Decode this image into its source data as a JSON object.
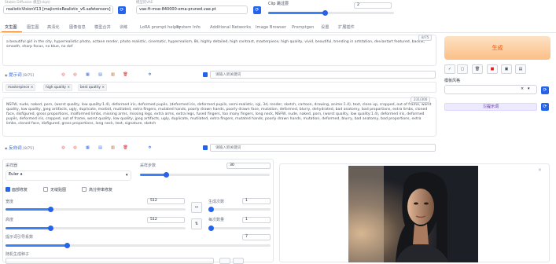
{
  "top": {
    "model_label": "Stable Diffusion 模型(ckpt)",
    "model_value": "realisticVisionV13 [majicmixRealistic_v6.safetensors]",
    "vae_label": "模型的VAE",
    "vae_value": "vae-ft-mse-840000-ema-pruned.vae.pt",
    "clip_label": "Clip 跳过层",
    "clip_value": "2",
    "clip_level": 0.45
  },
  "tabs": [
    "文生图",
    "图生图",
    "高清化",
    "图像信息",
    "模型合并",
    "训练",
    "LoRA prompt helper",
    "System Info",
    "Additional Networks",
    "Image Browser",
    "Promptgen",
    "设置",
    "扩展插件"
  ],
  "prompt": {
    "text": "a beautiful girl in the city, hyperrealistic photo, octane render, photo realistic, cinematic, hyperrealism, 8k, highly detailed, high contrast, masterpiece, high quality, vivid, beautiful, trending in artstation, deviantart featured, backlit, smooth, sharp focus, no blue, no dof",
    "counter": "8/75",
    "section_label": "提示词",
    "section_count": "[8/75]",
    "keyword_placeholder": "请输入新关键词",
    "chips": [
      "masterpiece",
      "high quality",
      "best quality"
    ]
  },
  "negative": {
    "text": "NSFW, nude, naked, porn, (worst quality, low quality:1.4), deformed iris, deformed pupils, (deformed iris, deformed pupils, semi-realistic, cgi, 3d, render, sketch, cartoon, drawing, anime:1.4), text, close up, cropped, out of frame, worst quality, low quality, jpeg artifacts, ugly, duplicate, morbid, mutilated, extra fingers, mutated hands, poorly drawn hands, poorly drawn face, mutation, deformed, blurry, dehydrated, bad anatomy, bad proportions, extra limbs, cloned face, disfigured, gross proportions, malformed limbs, missing arms, missing legs, extra arms, extra legs, fused fingers, too many fingers, long neck, NSFW, nude, naked, porn, (worst quality, low quality:1.4), deformed iris, deformed pupils, deformed iris, cropped, out of frame, worst quality, low quality, jpeg artifacts, ugly, duplicate, mutilated, extra fingers, mutated hands, poorly drawn hands, mutation, deformed, blurry, bad anatomy, bad proportions, extra limbs, cloned face, disfigured, gross proportions, long neck, text, signature, sketch",
    "counter": "231/300",
    "section_label": "反向词",
    "section_count": "[8/75]",
    "keyword_placeholder": "请输入新关键词"
  },
  "right_panel": {
    "generate_label": "生成",
    "style_label": "模板风格",
    "style_clear": "×",
    "style_arrow": "▾",
    "extra_label": "🅂提示词"
  },
  "settings": {
    "sampler_label": "采样器",
    "sampler_value": "Euler a",
    "steps_label": "采样步数",
    "steps_value": "30",
    "steps_level": 0.2,
    "restore_faces": "面部修复",
    "tiling": "无缝贴图",
    "hires_fix": "高分辨率修复",
    "width_label": "宽度",
    "width_value": "512",
    "width_level": 0.25,
    "height_label": "高度",
    "height_value": "512",
    "height_level": 0.25,
    "batch_count_label": "生成次数",
    "batch_count_value": "1",
    "batch_count_level": 0.0,
    "batch_size_label": "每次数量",
    "batch_size_value": "1",
    "batch_size_level": 0.0,
    "cfg_label": "提示词引导系数",
    "cfg_value": "7",
    "cfg_level": 0.23,
    "seed_label": "随机生成种子",
    "swap_icon": "⇅",
    "preset_icon": "↔"
  }
}
